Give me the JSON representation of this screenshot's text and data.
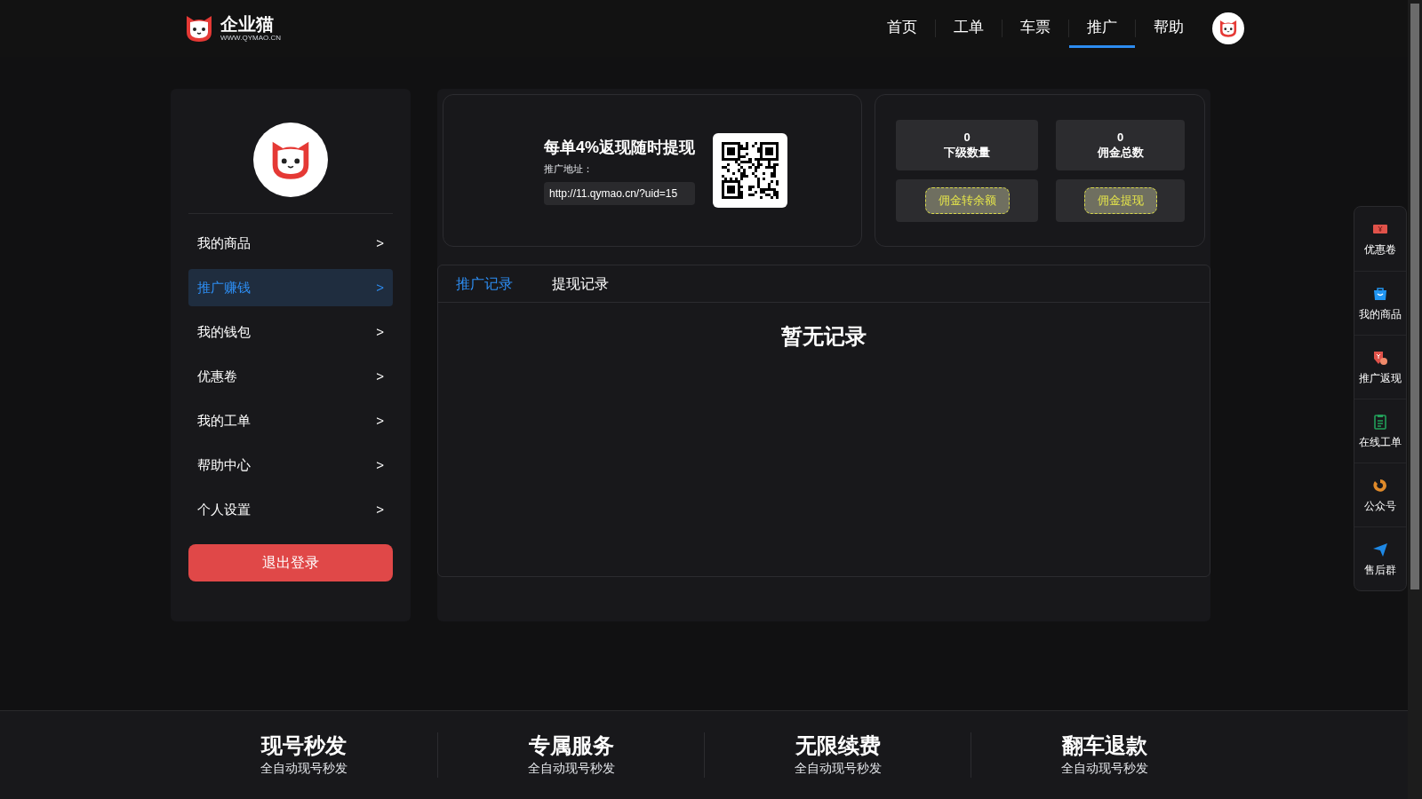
{
  "header": {
    "logo_text": "企业猫",
    "logo_sub": "WWW.QYMAO.CN",
    "nav": [
      {
        "label": "首页",
        "selected": false
      },
      {
        "label": "工单",
        "selected": false
      },
      {
        "label": "车票",
        "selected": false
      },
      {
        "label": "推广",
        "selected": true
      },
      {
        "label": "帮助",
        "selected": false
      }
    ]
  },
  "sidebar": {
    "items": [
      {
        "label": "我的商品",
        "arrow": ">",
        "selected": false
      },
      {
        "label": "推广赚钱",
        "arrow": ">",
        "selected": true
      },
      {
        "label": "我的钱包",
        "arrow": ">",
        "selected": false
      },
      {
        "label": "优惠卷",
        "arrow": ">",
        "selected": false
      },
      {
        "label": "我的工单",
        "arrow": ">",
        "selected": false
      },
      {
        "label": "帮助中心",
        "arrow": ">",
        "selected": false
      },
      {
        "label": "个人设置",
        "arrow": ">",
        "selected": false
      }
    ],
    "logout": "退出登录"
  },
  "promo": {
    "title": "每单4%返现随时提现",
    "address_label": "推广地址：",
    "url": "http://11.qymao.cn/?uid=15"
  },
  "stats": [
    {
      "value": "0",
      "label": "下级数量",
      "button": "佣金转余额"
    },
    {
      "value": "0",
      "label": "佣金总数",
      "button": "佣金提现"
    }
  ],
  "tabs": [
    {
      "label": "推广记录",
      "selected": true
    },
    {
      "label": "提现记录",
      "selected": false
    }
  ],
  "empty_text": "暂无记录",
  "float_bar": [
    {
      "kind": "coupon",
      "label": "优惠卷"
    },
    {
      "kind": "bag",
      "label": "我的商品"
    },
    {
      "kind": "cashback",
      "label": "推广返现"
    },
    {
      "kind": "clipboard",
      "label": "在线工单"
    },
    {
      "kind": "swirl",
      "label": "公众号"
    },
    {
      "kind": "plane",
      "label": "售后群"
    }
  ],
  "footer": [
    {
      "title": "现号秒发",
      "subtitle": "全自动现号秒发"
    },
    {
      "title": "专属服务",
      "subtitle": "全自动现号秒发"
    },
    {
      "title": "无限续费",
      "subtitle": "全自动现号秒发"
    },
    {
      "title": "翻车退款",
      "subtitle": "全自动现号秒发"
    }
  ]
}
